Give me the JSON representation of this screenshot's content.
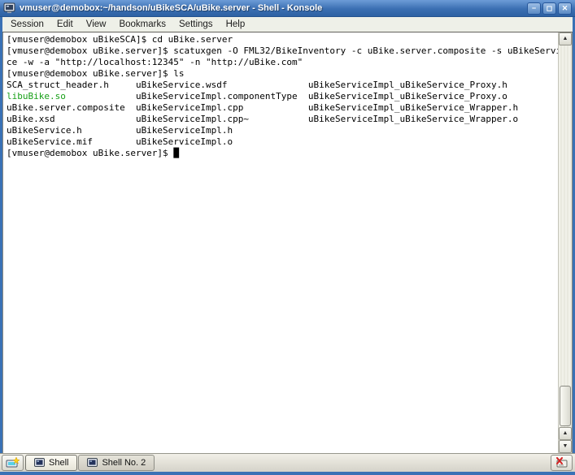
{
  "window": {
    "title": "vmuser@demobox:~/handson/uBikeSCA/uBike.server - Shell - Konsole",
    "controls": {
      "minimize": "−",
      "maximize": "◻",
      "close": "✕"
    }
  },
  "menu": {
    "items": [
      "Session",
      "Edit",
      "View",
      "Bookmarks",
      "Settings",
      "Help"
    ]
  },
  "terminal": {
    "lines": [
      [
        {
          "t": "[vmuser@demobox uBikeSCA]$ cd uBike.server"
        }
      ],
      [
        {
          "t": "[vmuser@demobox uBike.server]$ scatuxgen -O FML32/BikeInventory -c uBike.server.composite -s uBikeServi"
        }
      ],
      [
        {
          "t": "ce -w -a \"http://localhost:12345\" -n \"http://uBike.com\""
        }
      ],
      [
        {
          "t": "[vmuser@demobox uBike.server]$ ls"
        }
      ],
      [
        {
          "t": "SCA_struct_header.h     uBikeService.wsdf               uBikeServiceImpl_uBikeService_Proxy.h"
        }
      ],
      [
        {
          "t": "libuBike.so",
          "c": "green"
        },
        {
          "t": "             uBikeServiceImpl.componentType  uBikeServiceImpl_uBikeService_Proxy.o"
        }
      ],
      [
        {
          "t": "uBike.server.composite  uBikeServiceImpl.cpp            uBikeServiceImpl_uBikeService_Wrapper.h"
        }
      ],
      [
        {
          "t": "uBike.xsd               uBikeServiceImpl.cpp~           uBikeServiceImpl_uBikeService_Wrapper.o"
        }
      ],
      [
        {
          "t": "uBikeService.h          uBikeServiceImpl.h"
        }
      ],
      [
        {
          "t": "uBikeService.mif        uBikeServiceImpl.o"
        }
      ],
      [
        {
          "t": "[vmuser@demobox uBike.server]$ "
        },
        {
          "t": "█",
          "c": "cursor"
        }
      ]
    ]
  },
  "scrollbar": {
    "up_glyph": "▲",
    "down_glyph": "▼"
  },
  "tabbar": {
    "tabs": [
      {
        "label": "Shell",
        "active": true
      },
      {
        "label": "Shell No. 2",
        "active": false
      }
    ]
  },
  "colors": {
    "titlebar_blue": "#3b6fb2",
    "window_border_blue": "#3a71b5",
    "highlight_green": "#18a018",
    "terminal_background": "#ffffff",
    "terminal_text": "#000000"
  }
}
